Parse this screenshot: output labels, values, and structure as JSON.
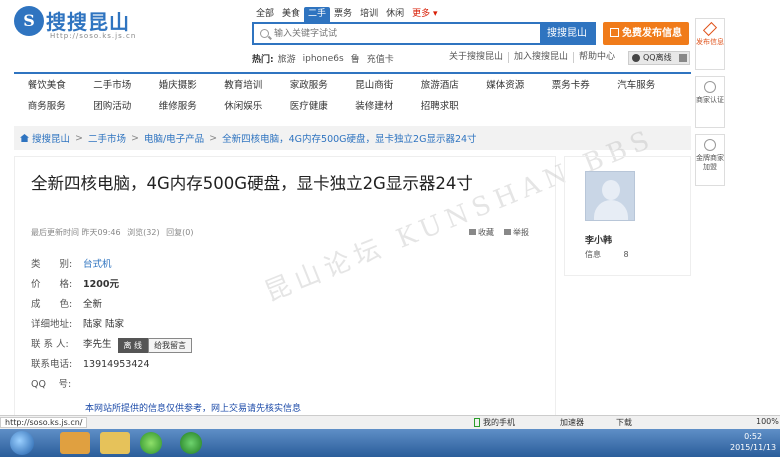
{
  "logo": {
    "mark": "S",
    "text": "搜搜昆山",
    "url": "Http://soso.ks.js.cn"
  },
  "category_tabs": [
    {
      "label": "全部",
      "active": false
    },
    {
      "label": "美食",
      "active": false
    },
    {
      "label": "二手",
      "active": true
    },
    {
      "label": "票务",
      "active": false
    },
    {
      "label": "培训",
      "active": false
    },
    {
      "label": "休闲",
      "active": false
    },
    {
      "label": "更多 ▾",
      "active": false
    }
  ],
  "search": {
    "placeholder": "输入关键字试试",
    "button": "搜搜昆山"
  },
  "post_button": "免费发布信息",
  "hot": {
    "label": "热门:",
    "links": [
      "旅游",
      "iphone6s",
      "鲁",
      "充值卡"
    ]
  },
  "top_links": [
    "关于搜搜昆山",
    "加入搜搜昆山",
    "帮助中心"
  ],
  "qq_status": "QQ离线",
  "side_float": [
    {
      "label": "发布信息"
    },
    {
      "label": "商家认证"
    },
    {
      "label": "金牌商家加盟"
    }
  ],
  "nav": {
    "row1": [
      "餐饮美食",
      "二手市场",
      "婚庆摄影",
      "教育培训",
      "家政服务",
      "昆山商街",
      "旅游酒店",
      "媒体资源",
      "票务卡券",
      "汽车服务"
    ],
    "row2": [
      "商务服务",
      "团购活动",
      "维修服务",
      "休闲娱乐",
      "医疗健康",
      "装修建材",
      "招聘求职"
    ]
  },
  "breadcrumb": [
    "搜搜昆山",
    "二手市场",
    "电脑/电子产品",
    "全新四核电脑，4G内存500G硬盘，显卡独立2G显示器24寸"
  ],
  "listing": {
    "title": "全新四核电脑，4G内存500G硬盘，显卡独立2G显示器24寸",
    "updated": "最后更新时间 昨天09:46",
    "views": "浏览(32)",
    "replies": "回复(0)",
    "favorite": "收藏",
    "report": "举报",
    "fields": [
      {
        "label": "类　　别:",
        "value": "台式机"
      },
      {
        "label": "价　　格:",
        "value": "1200元"
      },
      {
        "label": "成　　色:",
        "value": "全新"
      },
      {
        "label": "详细地址:",
        "value": "陆家 陆家"
      },
      {
        "label": "联 系 人:",
        "value": "李先生"
      },
      {
        "label": "联系电话:",
        "value": "13914953424"
      },
      {
        "label": "QQ　 号:",
        "value": ""
      }
    ],
    "contact_offline": "离 线",
    "contact_message": "给我留言",
    "disclaimer": "本网站所提供的信息仅供参考，网上交易请先核实信息"
  },
  "watermark": "昆山论坛 KUNSHAN BBS",
  "user": {
    "name": "李小韩",
    "info_label": "信息",
    "info_count": "8"
  },
  "statusbar": {
    "url": "http://soso.ks.js.cn/",
    "phone": "我的手机",
    "accelerator": "加速器",
    "download": "下载",
    "zoom": "100%"
  },
  "clock": {
    "time": "0:52",
    "date": "2015/11/13"
  }
}
